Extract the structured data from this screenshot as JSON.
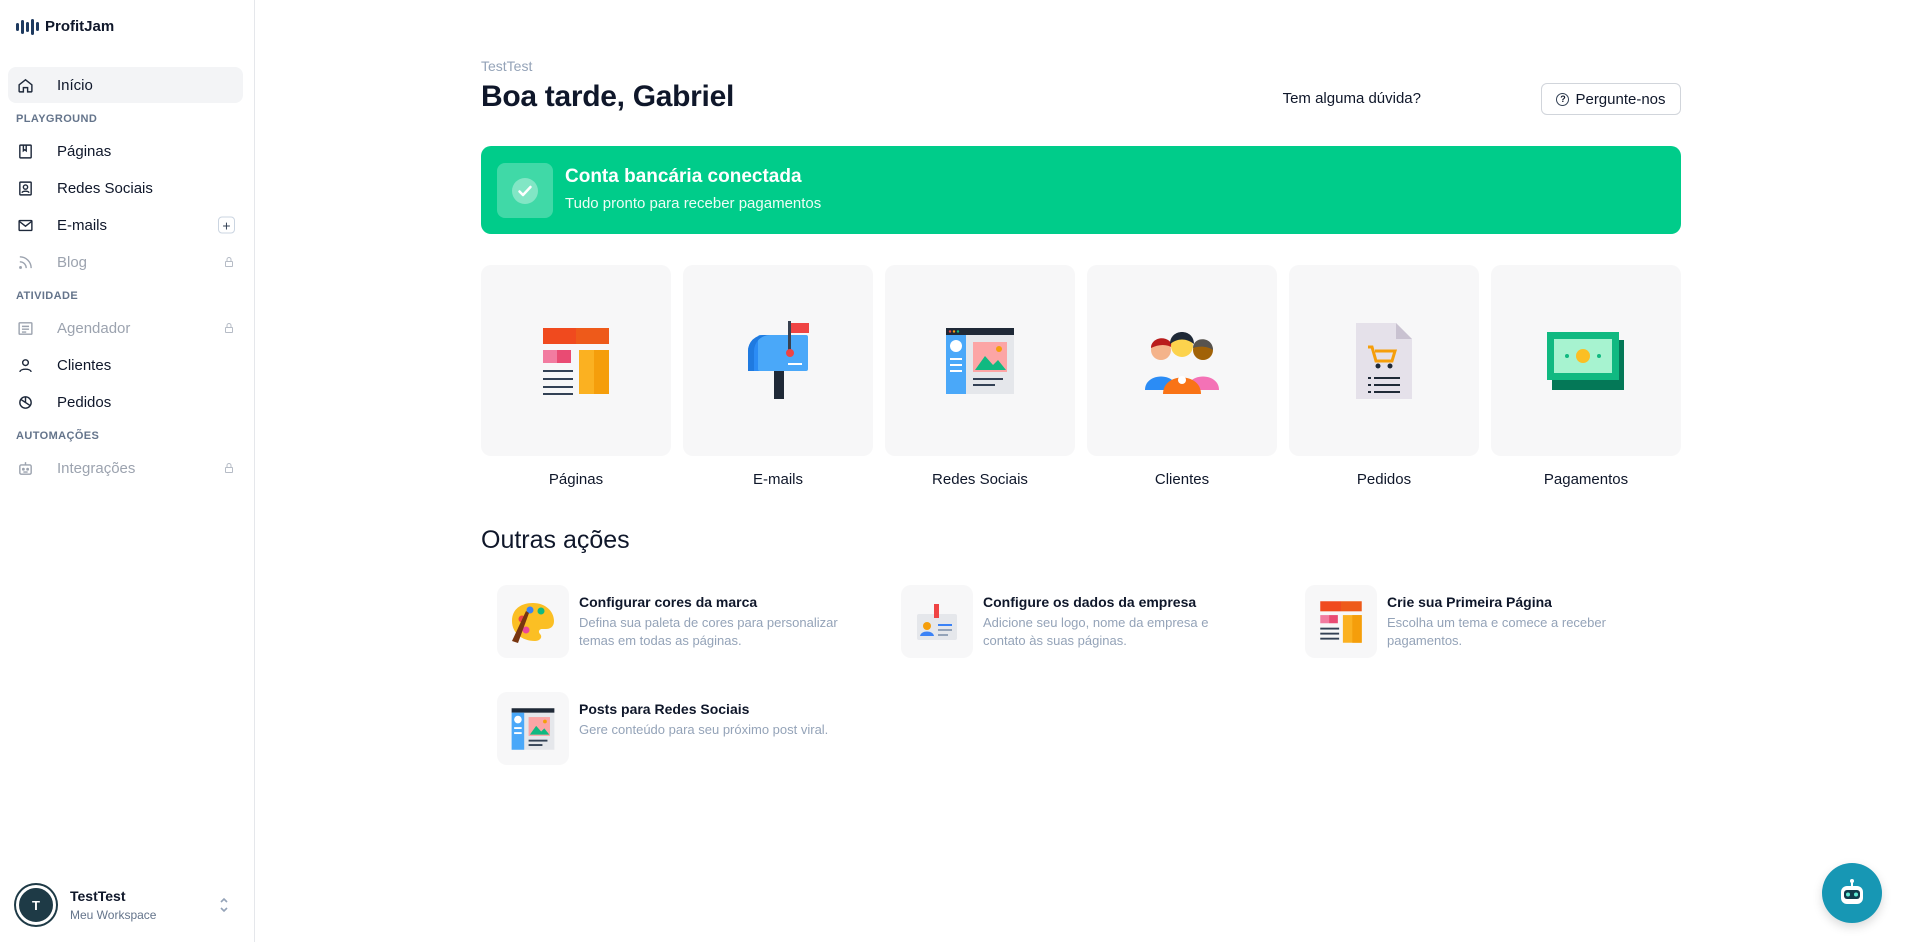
{
  "brand": {
    "name": "ProfitJam"
  },
  "sidebar": {
    "home": "Início",
    "sections": {
      "playground": "PLAYGROUND",
      "atividade": "ATIVIDADE",
      "automacoes": "AUTOMAÇÕES"
    },
    "items": {
      "paginas": "Páginas",
      "redes": "Redes Sociais",
      "emails": "E-mails",
      "blog": "Blog",
      "agendador": "Agendador",
      "clientes": "Clientes",
      "pedidos": "Pedidos",
      "integracoes": "Integrações"
    },
    "emails_add": "+"
  },
  "user": {
    "initial": "T",
    "name": "TestTest",
    "workspace": "Meu Workspace"
  },
  "header": {
    "workspace": "TestTest",
    "greeting": "Boa tarde, Gabriel",
    "question": "Tem alguma dúvida?",
    "ask_button": "Pergunte-nos"
  },
  "banner": {
    "title": "Conta bancária conectada",
    "subtitle": "Tudo pronto para receber pagamentos"
  },
  "tiles": {
    "paginas": "Páginas",
    "emails": "E-mails",
    "redes": "Redes Sociais",
    "clientes": "Clientes",
    "pedidos": "Pedidos",
    "pagamentos": "Pagamentos"
  },
  "other": {
    "title": "Outras ações",
    "cores": {
      "title": "Configurar cores da marca",
      "desc": "Defina sua paleta de cores para personalizar temas em todas as páginas."
    },
    "empresa": {
      "title": "Configure os dados da empresa",
      "desc": "Adicione seu logo, nome da empresa e contato às suas páginas."
    },
    "pagina": {
      "title": "Crie sua Primeira Página",
      "desc": "Escolha um tema e comece a receber pagamentos."
    },
    "posts": {
      "title": "Posts para Redes Sociais",
      "desc": "Gere conteúdo para seu próximo post viral."
    }
  },
  "colors": {
    "accent_green": "#00cc8a",
    "chatbot": "#1797b4",
    "text": "#0f172a"
  }
}
